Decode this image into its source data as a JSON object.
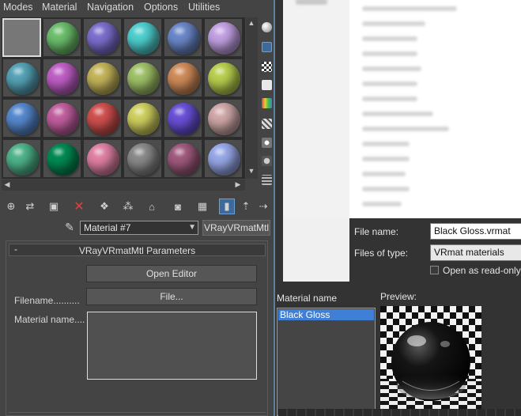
{
  "menubar": {
    "items": [
      "Modes",
      "Material",
      "Navigation",
      "Options",
      "Utilities"
    ]
  },
  "slots": {
    "colors": [
      "#7a7a7a",
      "#6cbf6c",
      "#7c6fcf",
      "#4fcfcf",
      "#6b88c9",
      "#c3a1e3",
      "#56a3b8",
      "#c05fc6",
      "#c4b45a",
      "#9fc168",
      "#d08c5a",
      "#b8cf4f",
      "#5789cf",
      "#c25f9f",
      "#d0504e",
      "#cfcf5f",
      "#6a50d8",
      "#d0a8a8",
      "#4fb48a",
      "#008a52",
      "#e080a4",
      "#8a8a8a",
      "#a05a7e",
      "#98a8e8"
    ],
    "active_index": 0
  },
  "editor": {
    "material_name": "Material #7",
    "material_type": "VRayVRmatMtl",
    "rollout_collapse": "-",
    "rollout_title": "VRayVRmatMtl Parameters",
    "open_editor_label": "Open Editor",
    "filename_label": "Filename..........",
    "file_button_label": "File...",
    "material_name_label": "Material name...."
  },
  "dialog": {
    "file_name_label": "File name:",
    "file_name_value": "Black Gloss.vrmat",
    "files_of_type_label": "Files of type:",
    "files_of_type_value": "VRmat materials",
    "read_only_label": "Open as read-only",
    "material_name_header": "Material name",
    "preview_header": "Preview:",
    "materials": [
      "Black Gloss"
    ]
  },
  "icons": {
    "toolbar": [
      "get-material-icon",
      "put-to-scene-icon",
      "assign-to-selection-icon",
      "reset-map-icon",
      "make-copy-icon",
      "make-unique-icon",
      "put-to-library-icon",
      "material-id-icon",
      "show-in-viewport-icon",
      "show-end-result-icon",
      "go-to-parent-icon",
      "go-forward-icon"
    ],
    "side": [
      "sample-type-icon",
      "backlight-icon",
      "background-icon",
      "uv-tiling-icon",
      "video-color-check-icon",
      "make-preview-icon",
      "options-icon",
      "select-by-material-icon",
      "material-navigator-icon"
    ]
  },
  "colors": {
    "accent_selected": "#3f7fd6",
    "delete_red": "#e04040"
  }
}
